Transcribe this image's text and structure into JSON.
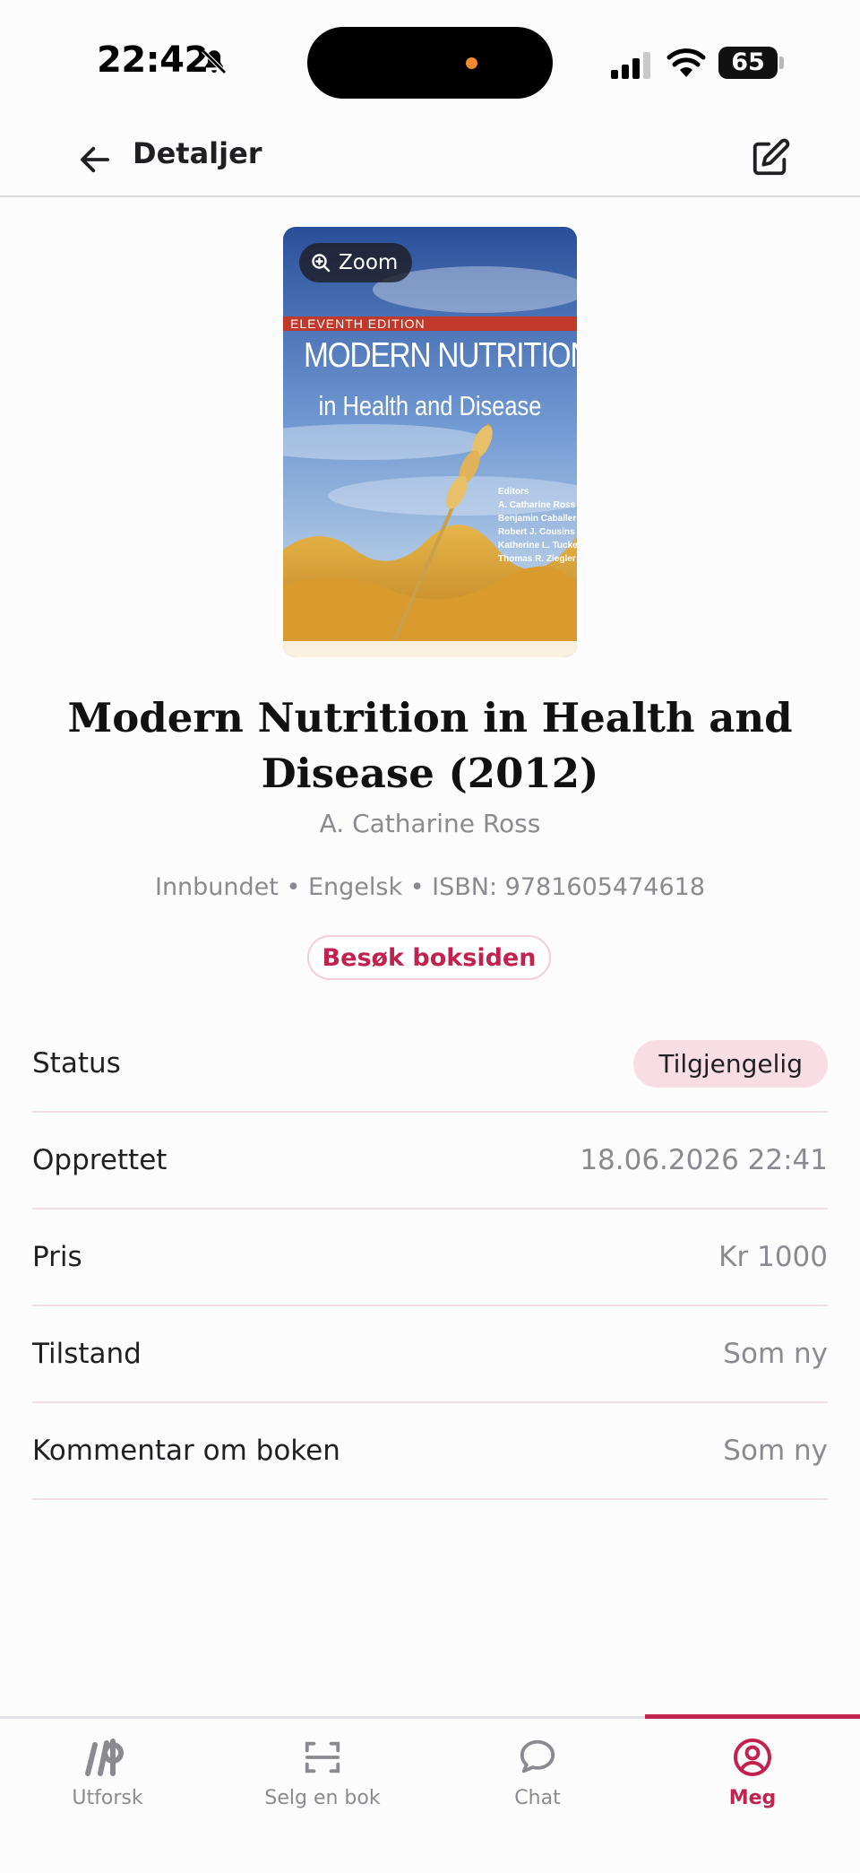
{
  "status_bar": {
    "time": "22:42",
    "battery": "65"
  },
  "header": {
    "title": "Detaljer"
  },
  "cover": {
    "zoom_label": "Zoom",
    "edition": "ELEVENTH EDITION",
    "title": "MODERN NUTRITION",
    "subtitle": "in Health and Disease",
    "editors": "Editors\nA. Catharine Ross\nBenjamin Caballero\nRobert J. Cousins\nKatherine L. Tucker\nThomas R. Ziegler"
  },
  "book": {
    "title": "Modern Nutrition in Health and Disease (2012)",
    "author": "A. Catharine Ross",
    "meta": "Innbundet • Engelsk • ISBN: 9781605474618",
    "visit_label": "Besøk boksiden"
  },
  "details": {
    "status": {
      "label": "Status",
      "value": "Tilgjengelig"
    },
    "created": {
      "label": "Opprettet",
      "value": "18.06.2026 22:41"
    },
    "price": {
      "label": "Pris",
      "value": "Kr 1000"
    },
    "condition": {
      "label": "Tilstand",
      "value": "Som ny"
    },
    "comment": {
      "label": "Kommentar om boken",
      "value": "Som ny"
    }
  },
  "nav": {
    "explore": "Utforsk",
    "sell": "Selg en bok",
    "chat": "Chat",
    "me": "Meg",
    "active": "me"
  },
  "colors": {
    "accent": "#c2224e",
    "badge_bg": "#f9dde4",
    "muted_text": "#8a8a90"
  }
}
